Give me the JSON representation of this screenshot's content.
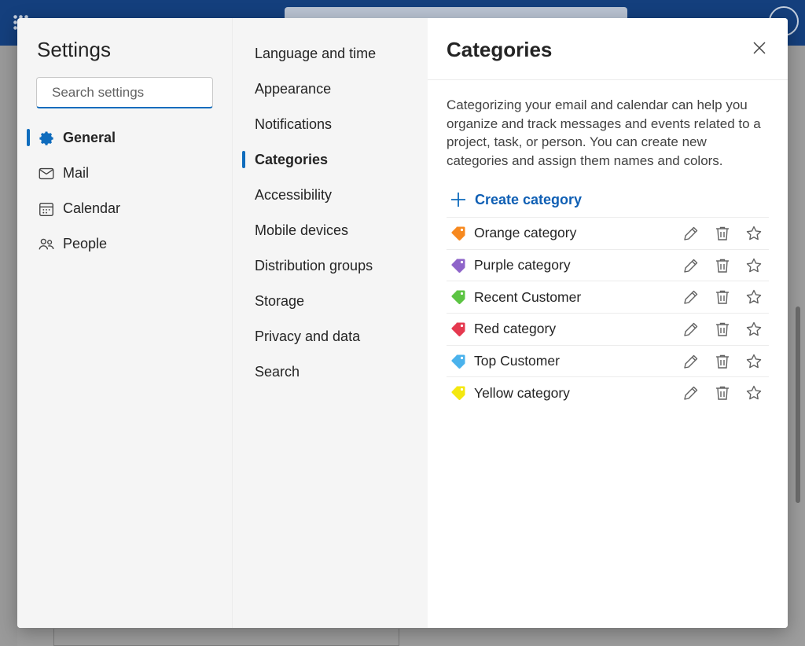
{
  "settings": {
    "title": "Settings",
    "search_placeholder": "Search settings"
  },
  "nav_primary": [
    {
      "label": "General",
      "icon": "gear-icon",
      "active": true
    },
    {
      "label": "Mail",
      "icon": "mail-icon",
      "active": false
    },
    {
      "label": "Calendar",
      "icon": "calendar-icon",
      "active": false
    },
    {
      "label": "People",
      "icon": "people-icon",
      "active": false
    }
  ],
  "nav_secondary": [
    {
      "label": "Language and time",
      "active": false
    },
    {
      "label": "Appearance",
      "active": false
    },
    {
      "label": "Notifications",
      "active": false
    },
    {
      "label": "Categories",
      "active": true
    },
    {
      "label": "Accessibility",
      "active": false
    },
    {
      "label": "Mobile devices",
      "active": false
    },
    {
      "label": "Distribution groups",
      "active": false
    },
    {
      "label": "Storage",
      "active": false
    },
    {
      "label": "Privacy and data",
      "active": false
    },
    {
      "label": "Search",
      "active": false
    }
  ],
  "pane": {
    "title": "Categories",
    "description": "Categorizing your email and calendar can help you organize and track messages and events related to a project, task, or person. You can create new categories and assign them names and colors.",
    "create_label": "Create category"
  },
  "categories": [
    {
      "name": "Orange category",
      "color": "#f7891f"
    },
    {
      "name": "Purple category",
      "color": "#8e64c9"
    },
    {
      "name": "Recent Customer",
      "color": "#5cc443"
    },
    {
      "name": "Red category",
      "color": "#e5394f"
    },
    {
      "name": "Top Customer",
      "color": "#4ab2ec"
    },
    {
      "name": "Yellow category",
      "color": "#f4e80f"
    }
  ],
  "colors": {
    "accent": "#0f6cbd",
    "top_bar": "#143f7d"
  }
}
